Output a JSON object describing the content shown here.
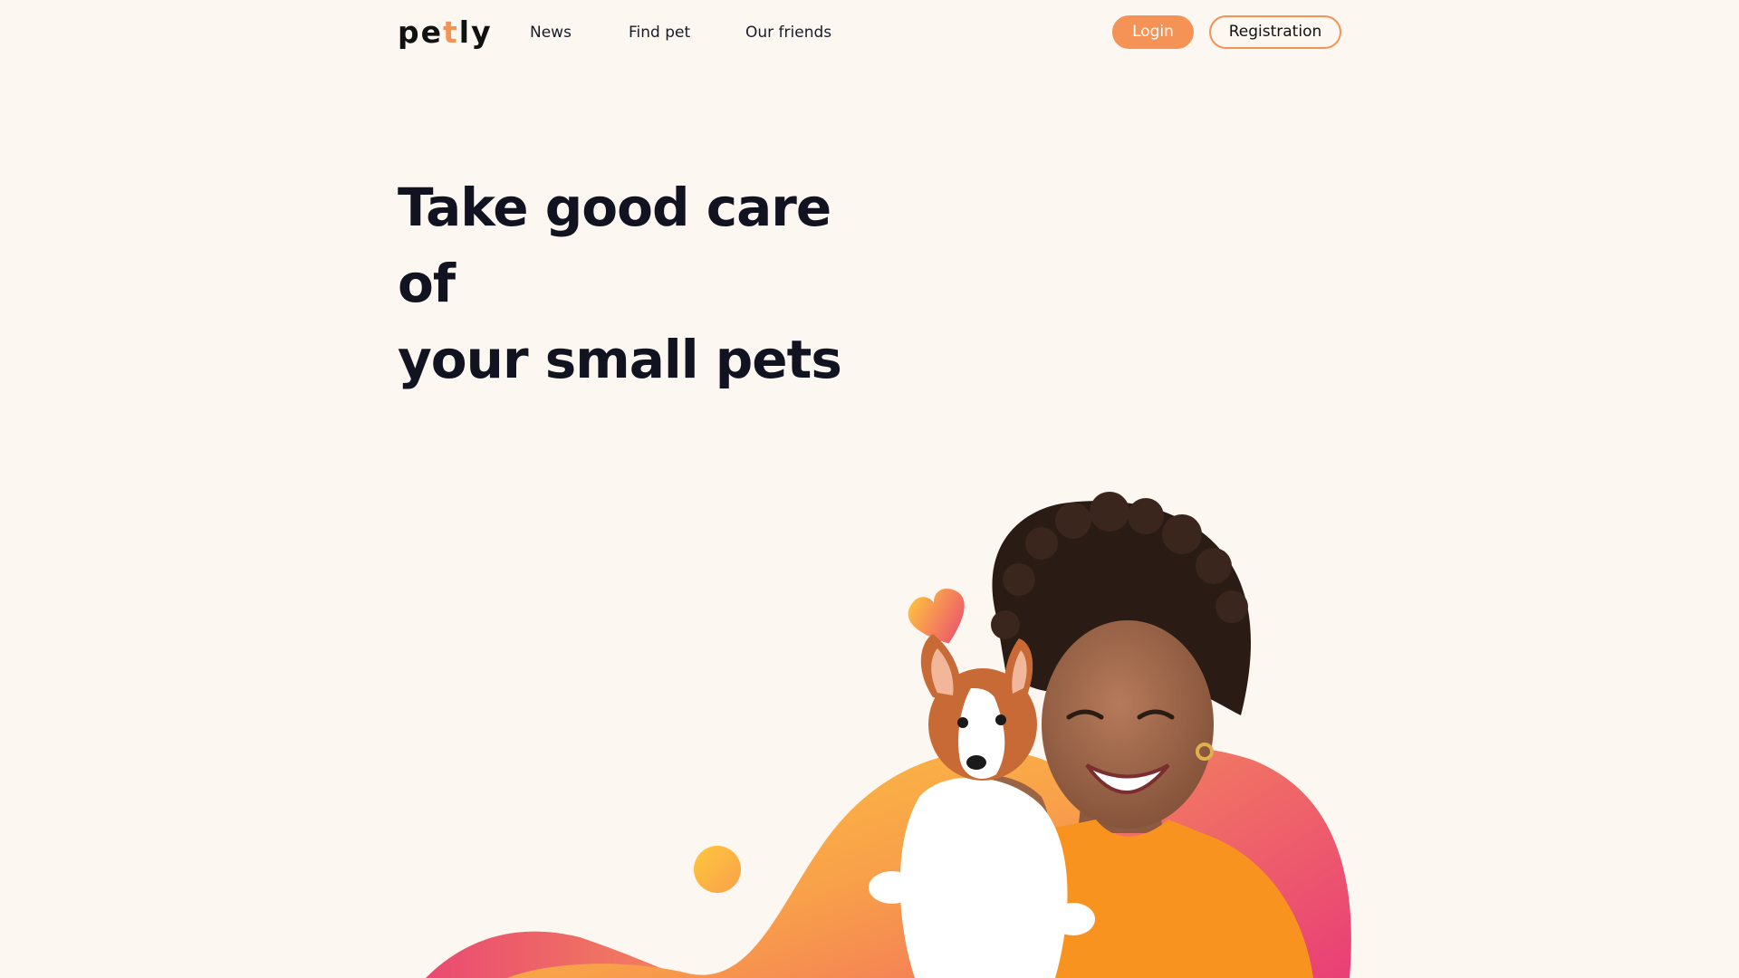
{
  "brand": {
    "logo_part1": "pe",
    "logo_accent": "t",
    "logo_part2": "ly"
  },
  "nav": {
    "items": [
      {
        "label": "News"
      },
      {
        "label": "Find pet"
      },
      {
        "label": "Our friends"
      }
    ]
  },
  "auth": {
    "login_label": "Login",
    "register_label": "Registration"
  },
  "hero": {
    "title_line1": "Take good care of",
    "title_line2": "your small pets"
  },
  "colors": {
    "background": "#FDF7F2",
    "accent": "#F59256",
    "text": "#111321",
    "blob_orange": "#FFC107",
    "blob_pink": "#E93F76",
    "sweater": "#F7931E"
  },
  "icons": {
    "heart": "heart-icon",
    "dot": "decorative-circle"
  }
}
